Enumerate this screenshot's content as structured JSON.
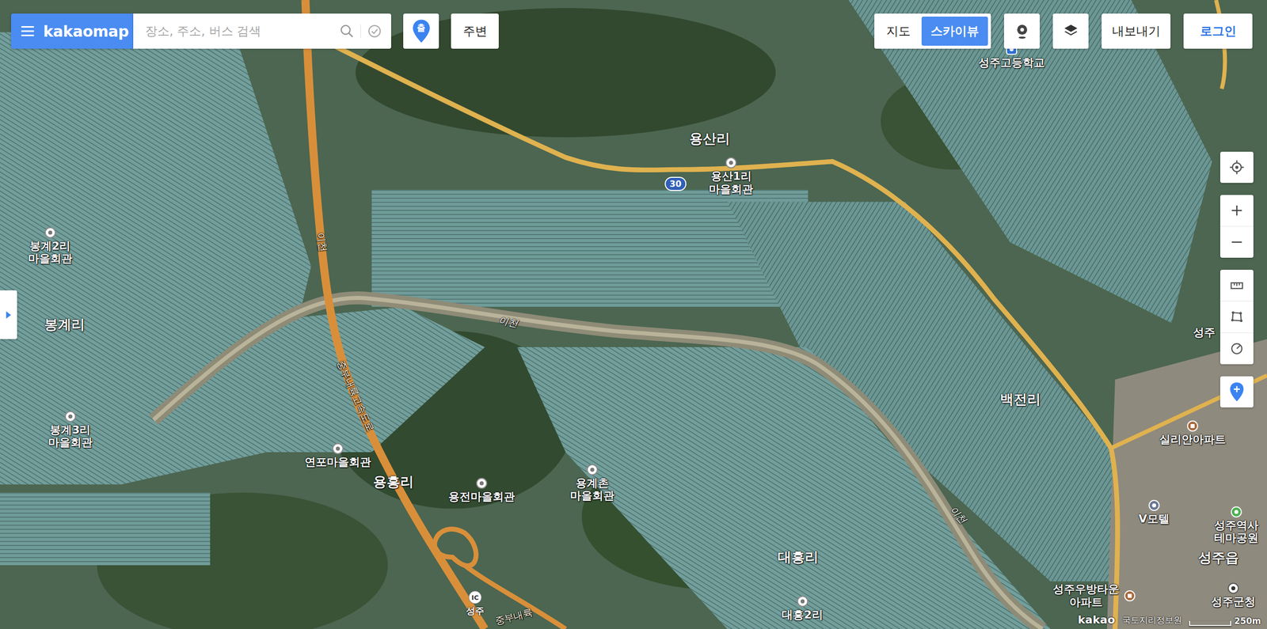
{
  "logo": "kakaomap",
  "search": {
    "placeholder": "장소, 주소, 버스 검색"
  },
  "directions_button": "출",
  "nearby_button": "주변",
  "map_types": [
    {
      "label": "지도",
      "selected": false
    },
    {
      "label": "스카이뷰",
      "selected": true
    }
  ],
  "export_button": "내보내기",
  "login_button": "로그인",
  "places": [
    {
      "kind": "area",
      "lines": [
        "용산리"
      ]
    },
    {
      "kind": "hall",
      "lines": [
        "용산1리",
        "마을회관"
      ]
    },
    {
      "kind": "school",
      "lines": [
        "성주고등학교"
      ]
    },
    {
      "kind": "hall",
      "lines": [
        "봉계2리",
        "마을회관"
      ]
    },
    {
      "kind": "area",
      "lines": [
        "봉계리"
      ]
    },
    {
      "kind": "hall",
      "lines": [
        "봉계3리",
        "마을회관"
      ]
    },
    {
      "kind": "hall",
      "lines": [
        "연포마을회관"
      ]
    },
    {
      "kind": "area",
      "lines": [
        "용흥리"
      ]
    },
    {
      "kind": "hall",
      "lines": [
        "용전마을회관"
      ]
    },
    {
      "kind": "hall",
      "lines": [
        "용계촌",
        "마을회관"
      ]
    },
    {
      "kind": "area",
      "lines": [
        "백전리"
      ]
    },
    {
      "kind": "apartment",
      "lines": [
        "실리안아파트"
      ]
    },
    {
      "kind": "lodging",
      "lines": [
        "V모텔"
      ]
    },
    {
      "kind": "park",
      "lines": [
        "성주역사",
        "테마공원"
      ]
    },
    {
      "kind": "area",
      "lines": [
        "성주읍"
      ]
    },
    {
      "kind": "area",
      "lines": [
        "대흥리"
      ]
    },
    {
      "kind": "hall",
      "lines": [
        "대흥2리"
      ]
    },
    {
      "kind": "apartment",
      "lines": [
        "성주우방타운",
        "아파트"
      ]
    },
    {
      "kind": "office",
      "lines": [
        "성주군청"
      ]
    },
    {
      "kind": "label",
      "lines": [
        "성주"
      ]
    },
    {
      "kind": "river",
      "lines": [
        "이천"
      ]
    },
    {
      "kind": "river",
      "lines": [
        "이천"
      ]
    },
    {
      "kind": "road",
      "lines": [
        "이천"
      ]
    },
    {
      "kind": "road",
      "lines": [
        "중부내륙고속도로"
      ]
    },
    {
      "kind": "road",
      "lines": [
        "중부내륙"
      ]
    }
  ],
  "route_shield": "30",
  "interchange": {
    "badge": "IC",
    "name": "성주"
  },
  "attribution": {
    "brand": "kakao",
    "source": "국토지리정보원"
  },
  "scale": "250m"
}
